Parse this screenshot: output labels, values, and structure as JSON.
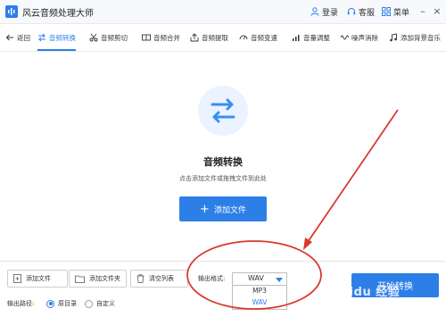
{
  "app": {
    "title": "风云音频处理大师"
  },
  "titlebar": {
    "login": "登录",
    "service": "客服",
    "menu": "菜单"
  },
  "toolbar": {
    "back": "返回",
    "items": [
      "音频转换",
      "音频剪切",
      "音频合并",
      "音频提取",
      "音频变速",
      "音量调整",
      "噪声消除",
      "添加背景音乐"
    ],
    "active_index": 0
  },
  "main": {
    "title": "音频转换",
    "subtitle": "点击添加文件或拖拽文件到此处",
    "add_button": "添加文件"
  },
  "bottom": {
    "add_file": "添加文件",
    "add_folder": "添加文件夹",
    "clear_list": "清空列表",
    "format_label": "输出格式:",
    "format_value": "WAV",
    "format_options": [
      "MP3",
      "WAV"
    ],
    "start_button": "开始转换",
    "output_label": "输出路径:",
    "output_options": [
      "原目录",
      "自定义"
    ],
    "output_selected_index": 0
  },
  "colors": {
    "accent": "#2d7fe8",
    "annotation": "#d93a2b"
  }
}
